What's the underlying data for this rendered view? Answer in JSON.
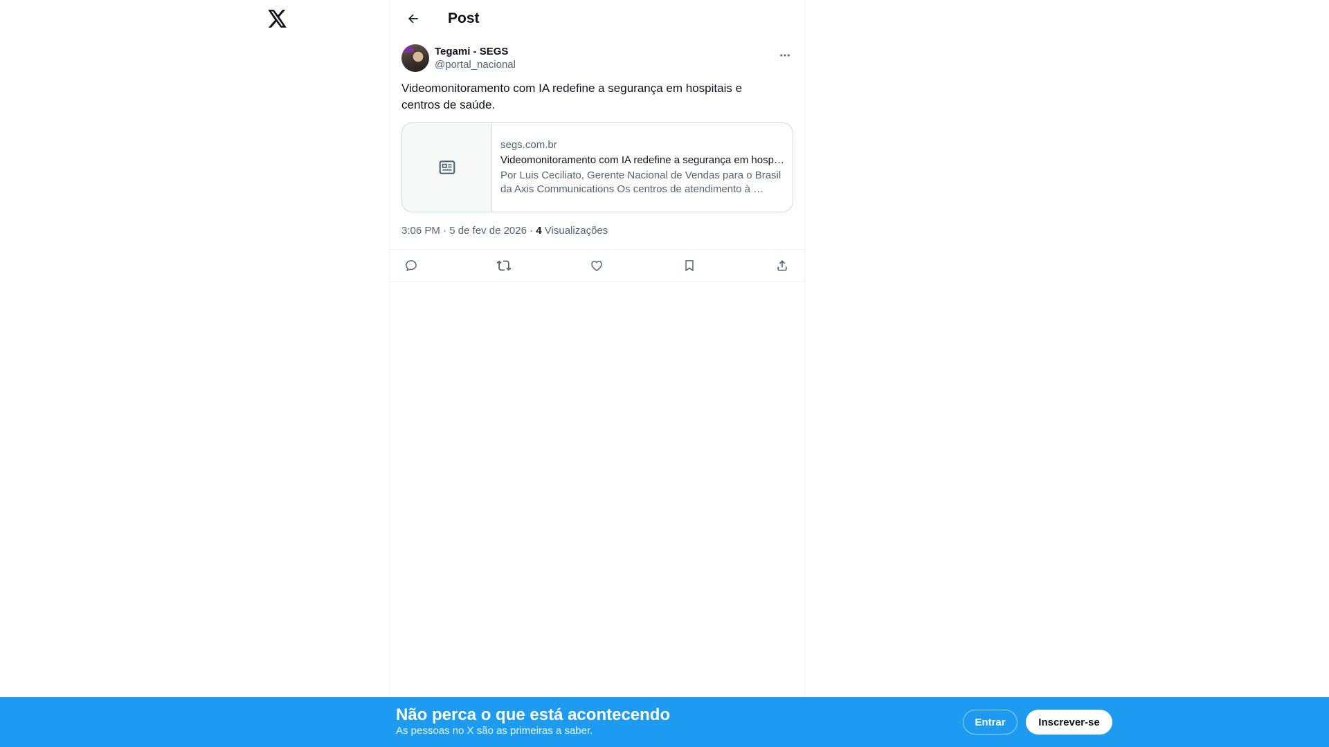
{
  "header": {
    "title": "Post"
  },
  "post": {
    "author_name": "Tegami - SEGS",
    "author_handle": "@portal_nacional",
    "text": "Videomonitoramento com IA redefine a segurança em hospitais e centros de saúde.",
    "card": {
      "domain": "segs.com.br",
      "title": "Videomonitoramento com IA redefine a segurança em hospitais e centros de saúde",
      "description": "Por Luis Ceciliato, Gerente Nacional de Vendas para o Brasil da Axis Communications Os centros de atendimento à …"
    },
    "time": "3:06 PM · 5 de fev de 2026 · ",
    "views_count": "4",
    "views_label": " Visualizações"
  },
  "banner": {
    "title": "Não perca o que está acontecendo",
    "subtitle": "As pessoas no X são as primeiras a saber.",
    "login_label": "Entrar",
    "signup_label": "Inscrever-se"
  },
  "colors": {
    "accent": "#1d9bf0",
    "text_primary": "#0f1419",
    "text_secondary": "#536471",
    "border": "#cfd9de"
  },
  "icons": [
    "x-logo-icon",
    "back-arrow-icon",
    "more-icon",
    "article-icon",
    "reply-icon",
    "repost-icon",
    "like-icon",
    "bookmark-icon",
    "share-icon"
  ]
}
